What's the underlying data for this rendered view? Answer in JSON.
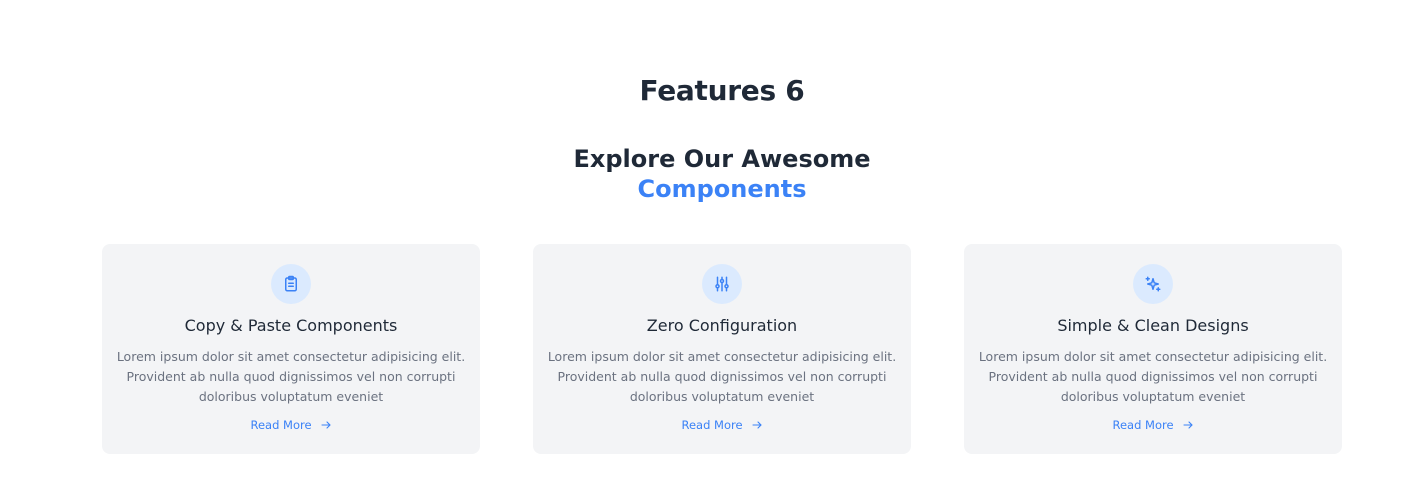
{
  "section": {
    "title": "Features 6",
    "heading_line1": "Explore Our Awesome",
    "heading_line2": "Components"
  },
  "colors": {
    "accent": "#3b82f6",
    "card_bg": "#f3f4f6",
    "icon_bg": "#dbeafe"
  },
  "cards": [
    {
      "icon": "clipboard-icon",
      "title": "Copy & Paste Components",
      "description": "Lorem ipsum dolor sit amet consectetur adipisicing elit. Provident ab nulla quod dignissimos vel non corrupti doloribus voluptatum eveniet",
      "link_label": "Read More"
    },
    {
      "icon": "sliders-icon",
      "title": "Zero Configuration",
      "description": "Lorem ipsum dolor sit amet consectetur adipisicing elit. Provident ab nulla quod dignissimos vel non corrupti doloribus voluptatum eveniet",
      "link_label": "Read More"
    },
    {
      "icon": "sparkles-icon",
      "title": "Simple & Clean Designs",
      "description": "Lorem ipsum dolor sit amet consectetur adipisicing elit. Provident ab nulla quod dignissimos vel non corrupti doloribus voluptatum eveniet",
      "link_label": "Read More"
    }
  ]
}
